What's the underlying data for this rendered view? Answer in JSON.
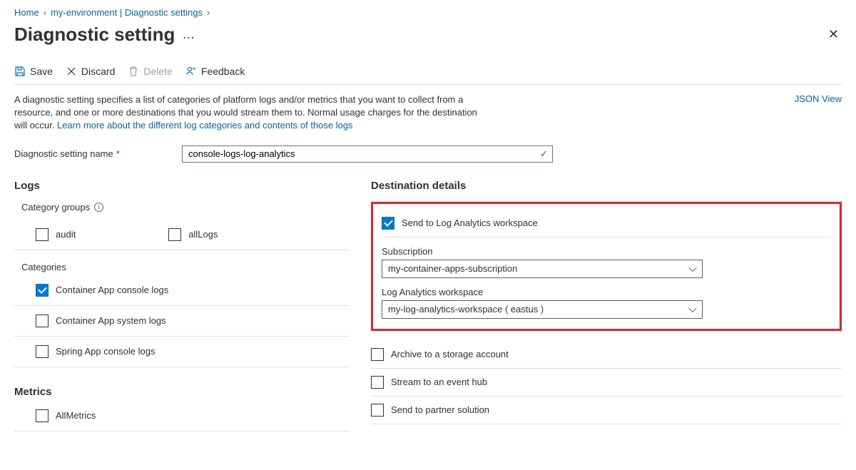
{
  "breadcrumb": {
    "home": "Home",
    "env": "my-environment | Diagnostic settings"
  },
  "page_title": "Diagnostic setting",
  "toolbar": {
    "save": "Save",
    "discard": "Discard",
    "delete": "Delete",
    "feedback": "Feedback"
  },
  "description": {
    "text": "A diagnostic setting specifies a list of categories of platform logs and/or metrics that you want to collect from a resource, and one or more destinations that you would stream them to. Normal usage charges for the destination will occur. ",
    "link": "Learn more about the different log categories and contents of those logs",
    "json_view": "JSON View"
  },
  "name_field": {
    "label": "Diagnostic setting name",
    "value": "console-logs-log-analytics"
  },
  "logs": {
    "title": "Logs",
    "category_groups_label": "Category groups",
    "groups": {
      "audit": "audit",
      "allLogs": "allLogs"
    },
    "categories_label": "Categories",
    "items": {
      "console": "Container App console logs",
      "system": "Container App system logs",
      "spring": "Spring App console logs"
    }
  },
  "metrics": {
    "title": "Metrics",
    "all": "AllMetrics"
  },
  "dest": {
    "title": "Destination details",
    "log_analytics": "Send to Log Analytics workspace",
    "subscription_label": "Subscription",
    "subscription_value": "my-container-apps-subscription",
    "workspace_label": "Log Analytics workspace",
    "workspace_value": "my-log-analytics-workspace ( eastus )",
    "storage": "Archive to a storage account",
    "eventhub": "Stream to an event hub",
    "partner": "Send to partner solution"
  }
}
